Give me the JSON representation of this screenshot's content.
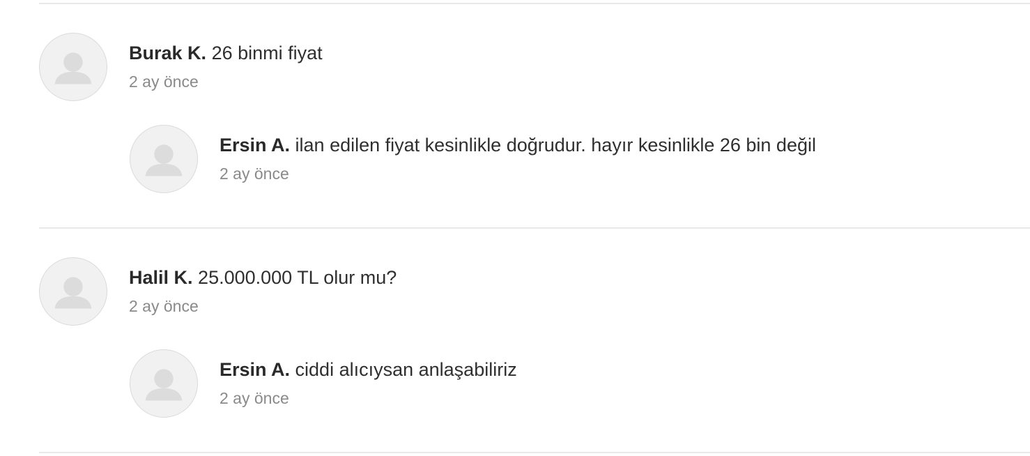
{
  "comments": [
    {
      "author": "Burak K.",
      "message": "26 binmi fiyat",
      "time": "2 ay önce",
      "reply": {
        "author": "Ersin A.",
        "message": "ilan edilen fiyat kesinlikle doğrudur. hayır kesinlikle 26 bin değil",
        "time": "2 ay önce"
      }
    },
    {
      "author": "Halil K.",
      "message": "25.000.000 TL olur mu?",
      "time": "2 ay önce",
      "reply": {
        "author": "Ersin A.",
        "message": "ciddi alıcıysan anlaşabiliriz",
        "time": "2 ay önce"
      }
    }
  ],
  "icons": {
    "avatar": "user-placeholder-icon"
  },
  "colors": {
    "divider": "#e9e9e9",
    "avatar_bg": "#f1f1f1",
    "avatar_glyph": "#dcdcdc",
    "time_text": "#8a8a8a"
  }
}
